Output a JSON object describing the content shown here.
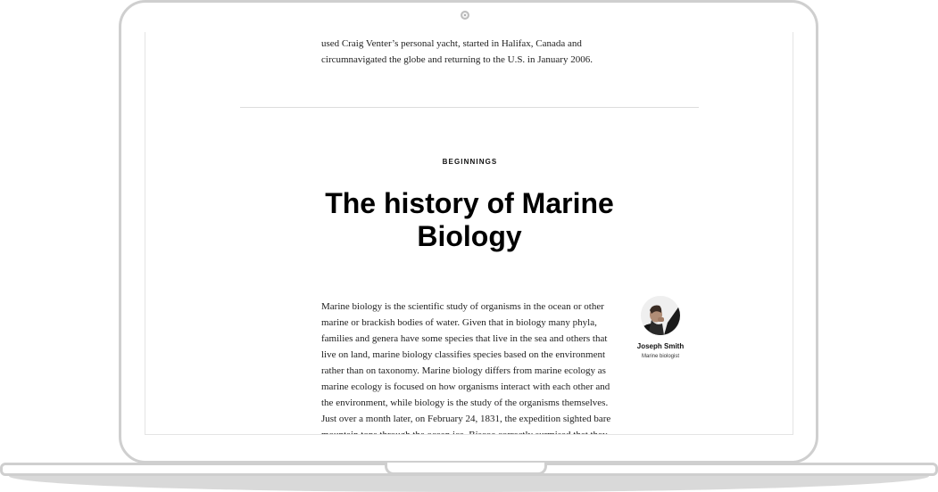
{
  "article": {
    "previous_text": "used Craig Venter’s personal yacht, started in Halifax, Canada and circumnavigated the globe and returning to the U.S. in January 2006.",
    "kicker": "BEGINNINGS",
    "title": "The history of Marine Biology",
    "paragraphs": [
      "Marine biology is the scientific study of organisms in the ocean or other marine or brackish bodies of water. Given that in biology many phyla, families and genera have some species that live in the sea and others that live on land, marine biology classifies species based on the environment rather than on taxonomy. Marine biology differs from marine ecology as marine ecology is focused on how organisms interact with each other and the environment, while biology is the study of the organisms themselves.",
      "Just over a month later, on February 24, 1831, the expedition sighted bare mountain tops through the ocean ice. Biscoe correctly surmised that they"
    ]
  },
  "author": {
    "name": "Joseph Smith",
    "role": "Marine biologist"
  }
}
